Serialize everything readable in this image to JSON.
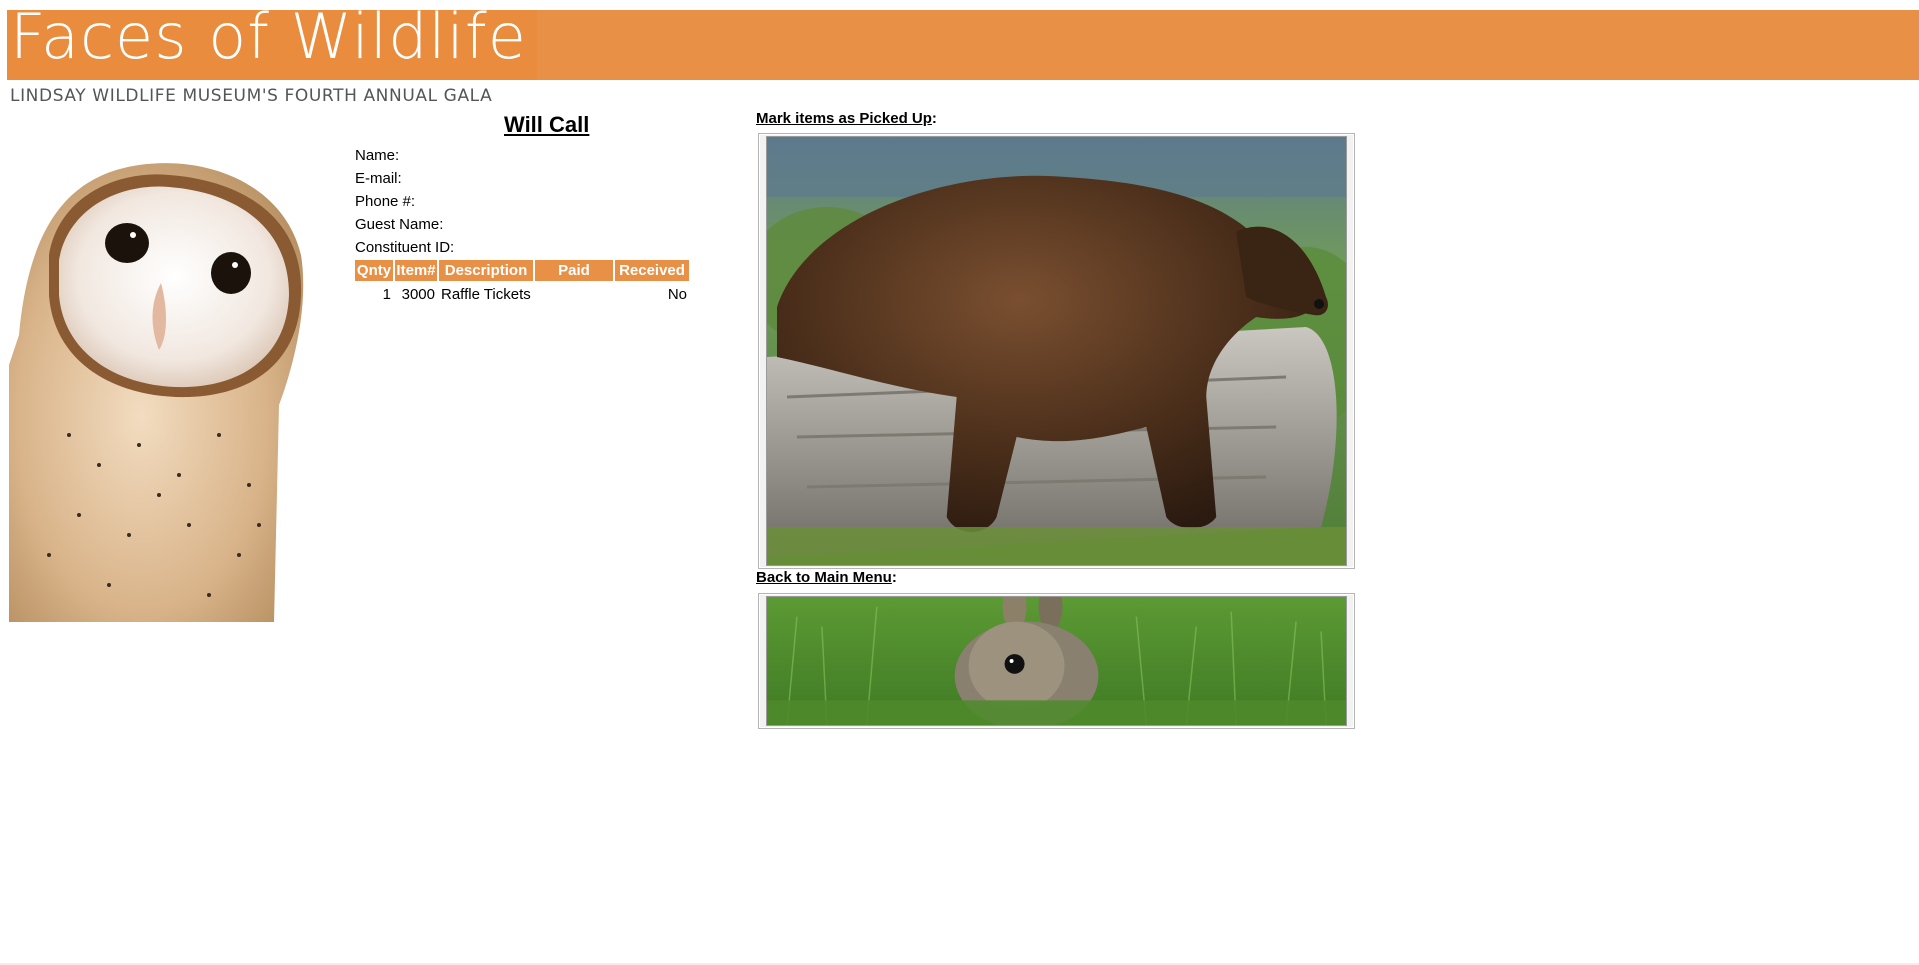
{
  "header": {
    "title": "Faces of Wildlife",
    "subtitle": "LINDSAY WILDLIFE MUSEUM'S FOURTH ANNUAL GALA",
    "accent_color": "#e89046"
  },
  "will_call": {
    "title": "Will Call",
    "fields": {
      "name": "Name:",
      "email": "E-mail:",
      "phone": "Phone #:",
      "guest_name": "Guest Name:",
      "constituent_id": "Constituent ID:"
    },
    "table": {
      "columns": [
        "Qnty",
        "Item#",
        "Description",
        "Paid",
        "Received"
      ],
      "rows": [
        {
          "qnty": "1",
          "item": "3000",
          "description": "Raffle Tickets",
          "paid": "",
          "received": "No"
        }
      ]
    }
  },
  "actions": {
    "mark_picked_up": {
      "link": "Mark items as Picked Up",
      "suffix": ":",
      "image_icon": "bear-on-log-image"
    },
    "back_to_main": {
      "link": "Back to Main Menu",
      "suffix": ":",
      "image_icon": "rabbit-in-grass-image"
    }
  },
  "images": {
    "owl": "barn-owl-image"
  }
}
